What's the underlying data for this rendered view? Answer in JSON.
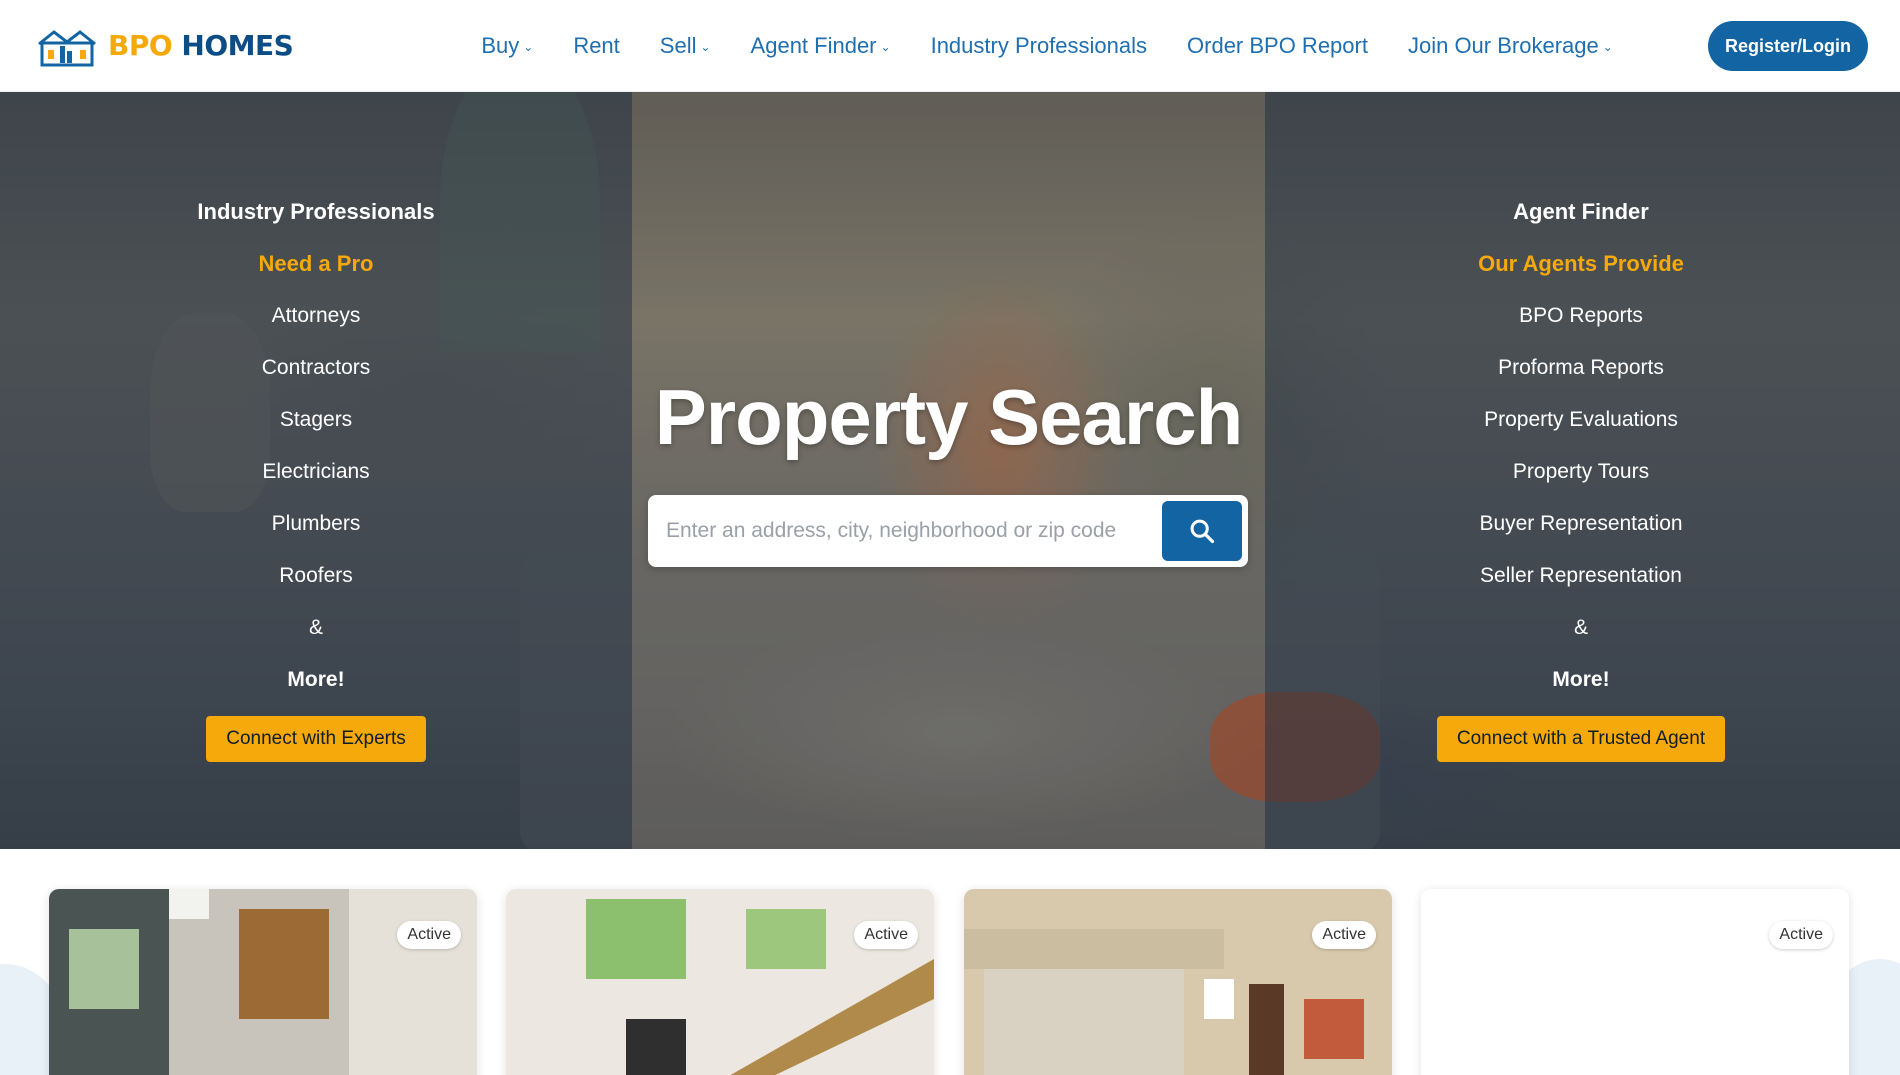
{
  "brand": {
    "part1": "BPO",
    "part2": "HOMES"
  },
  "nav": {
    "items": [
      {
        "label": "Buy",
        "has_dropdown": true
      },
      {
        "label": "Rent",
        "has_dropdown": false
      },
      {
        "label": "Sell",
        "has_dropdown": true
      },
      {
        "label": "Agent Finder",
        "has_dropdown": true
      },
      {
        "label": "Industry Professionals",
        "has_dropdown": false
      },
      {
        "label": "Order BPO Report",
        "has_dropdown": false
      },
      {
        "label": "Join Our Brokerage",
        "has_dropdown": true
      }
    ],
    "register_label": "Register/Login"
  },
  "hero": {
    "title": "Property Search",
    "search_placeholder": "Enter an address, city, neighborhood or zip code",
    "left": {
      "title": "Industry Professionals",
      "subtitle": "Need a Pro",
      "items": [
        "Attorneys",
        "Contractors",
        "Stagers",
        "Electricians",
        "Plumbers",
        "Roofers"
      ],
      "amp": "&",
      "more": "More!",
      "button": "Connect with Experts"
    },
    "right": {
      "title": "Agent Finder",
      "subtitle": "Our Agents Provide",
      "items": [
        "BPO Reports",
        "Proforma Reports",
        "Property Evaluations",
        "Property Tours",
        "Buyer Representation",
        "Seller Representation"
      ],
      "amp": "&",
      "more": "More!",
      "button": "Connect with a Trusted Agent"
    }
  },
  "listings": [
    {
      "status": "Active"
    },
    {
      "status": "Active"
    },
    {
      "status": "Active"
    },
    {
      "status": "Active"
    }
  ],
  "colors": {
    "accent": "#f5a90b",
    "primary": "#1364a3",
    "nav_text": "#1f6fb0"
  }
}
